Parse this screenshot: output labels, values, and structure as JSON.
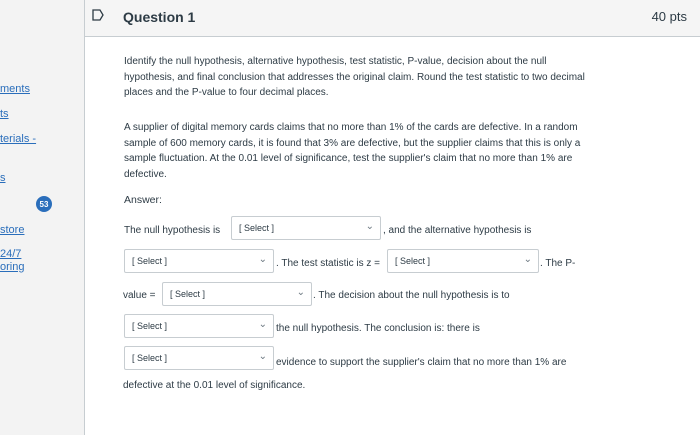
{
  "nav": {
    "links": [
      "ments",
      "ts",
      "terials -",
      "s",
      "store",
      "24/7",
      "oring"
    ],
    "badge": "53"
  },
  "question": {
    "title": "Question 1",
    "points": "40 pts",
    "instructions": "Identify the null hypothesis, alternative hypothesis, test statistic, P-value, decision about the null hypothesis, and final conclusion that addresses the original claim. Round the test statistic to two decimal places and the P-value to four decimal places.",
    "problem": "A supplier of digital memory cards claims that no more than 1% of the cards are defective. In a random sample of 600 memory cards, it is found that 3% are defective, but the supplier claims that this is only a sample fluctuation. At the 0.01 level of significance, test the supplier's claim that no more than 1% are defective.",
    "answer_label": "Answer:",
    "line1_prefix": "The null hypothesis is",
    "line1_suffix": ", and the alternative hypothesis is",
    "line2_middle": ". The test statistic is z =",
    "line2_suffix": ". The P-",
    "line3_prefix": "value =",
    "line3_suffix": ". The decision about the null hypothesis is to",
    "line4_suffix": "the null hypothesis. The conclusion is: there is",
    "line5_suffix": "evidence to support the supplier's claim that no more than 1% are",
    "line6": "defective at the 0.01 level of significance.",
    "select_placeholder": "[ Select ]"
  },
  "colors": {
    "link": "#2a6ebb",
    "text": "#2d3b45",
    "border": "#c7cdd1"
  },
  "icons": {
    "flag": "bookmark-flag-icon",
    "chevron": "chevron-down-icon"
  }
}
